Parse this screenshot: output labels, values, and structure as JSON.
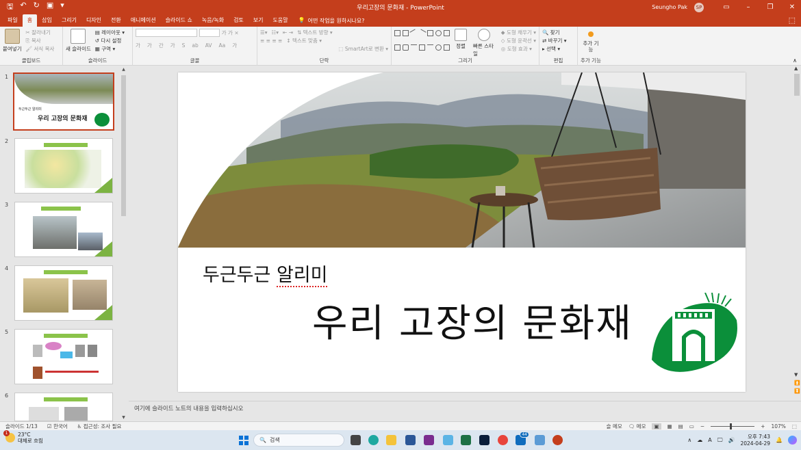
{
  "window": {
    "title": "우리고장의 문화재  -  PowerPoint",
    "user": "Seungho Pak",
    "avatar": "SP",
    "controls": [
      "ribbon-display-icon",
      "minimize-icon",
      "maximize-icon",
      "close-icon"
    ]
  },
  "quick_access": [
    "save-icon",
    "undo-icon",
    "redo-icon",
    "start-from-beginning-icon",
    "customize-icon"
  ],
  "tabs": [
    "파일",
    "홈",
    "삽입",
    "그리기",
    "디자인",
    "전환",
    "애니메이션",
    "슬라이드 쇼",
    "녹음/녹화",
    "검토",
    "보기",
    "도움말"
  ],
  "active_tab": "홈",
  "tell_me": "어떤 작업을 원하시나요?",
  "ribbon": {
    "clipboard": {
      "label": "클립보드",
      "paste": "붙여넣기",
      "cut": "잘라내기",
      "copy": "복사",
      "format_painter": "서식 복사"
    },
    "slides": {
      "label": "슬라이드",
      "new_slide": "새 슬라이드",
      "layout": "레이아웃",
      "reset": "다시 설정",
      "section": "구역"
    },
    "font": {
      "label": "글꼴",
      "buttons": [
        "가",
        "가",
        "간",
        "가",
        "S",
        "ab",
        "AV",
        "Aa",
        "가"
      ]
    },
    "paragraph": {
      "label": "단락",
      "text_direction": "텍스트 방향",
      "align_text": "텍스트 맞춤",
      "smartart": "SmartArt로 변환"
    },
    "drawing": {
      "label": "그리기",
      "arrange": "정렬",
      "quick_styles": "빠른 스타일",
      "shape_fill": "도형 채우기",
      "shape_outline": "도형 윤곽선",
      "shape_effects": "도형 효과"
    },
    "editing": {
      "label": "편집",
      "find": "찾기",
      "replace": "바꾸기",
      "select": "선택"
    },
    "addins": {
      "label": "추가 기능",
      "button": "추가 기능"
    }
  },
  "thumbnails": {
    "numbers": [
      "1",
      "2",
      "3",
      "4",
      "5",
      "6"
    ],
    "active": 1,
    "slide1_subtitle": "두근두근 알리미",
    "slide1_title": "우리 고장의 문화재"
  },
  "slide": {
    "subtitle": "두근두근 ",
    "subtitle_misspelled": "알리미",
    "title": "우리 고장의 문화재"
  },
  "notes": {
    "placeholder": "여기에 슬라이드 노트의 내용을 입력하십시오"
  },
  "status": {
    "slide_count": "슬라이드 1/13",
    "language": "한국어",
    "accessibility": "접근성: 조사 필요",
    "notes": "슬 메모",
    "comments": "메모",
    "zoom": "107%"
  },
  "taskbar": {
    "weather_temp": "23°C",
    "weather_desc": "대체로 흐림",
    "notification_count": "1",
    "search_placeholder": "검색",
    "app_badge": "44",
    "time": "오후 7:43",
    "date": "2024-04-29"
  },
  "colors": {
    "accent": "#c43e1c",
    "green": "#0b8f3a",
    "lime": "#7cb342"
  }
}
